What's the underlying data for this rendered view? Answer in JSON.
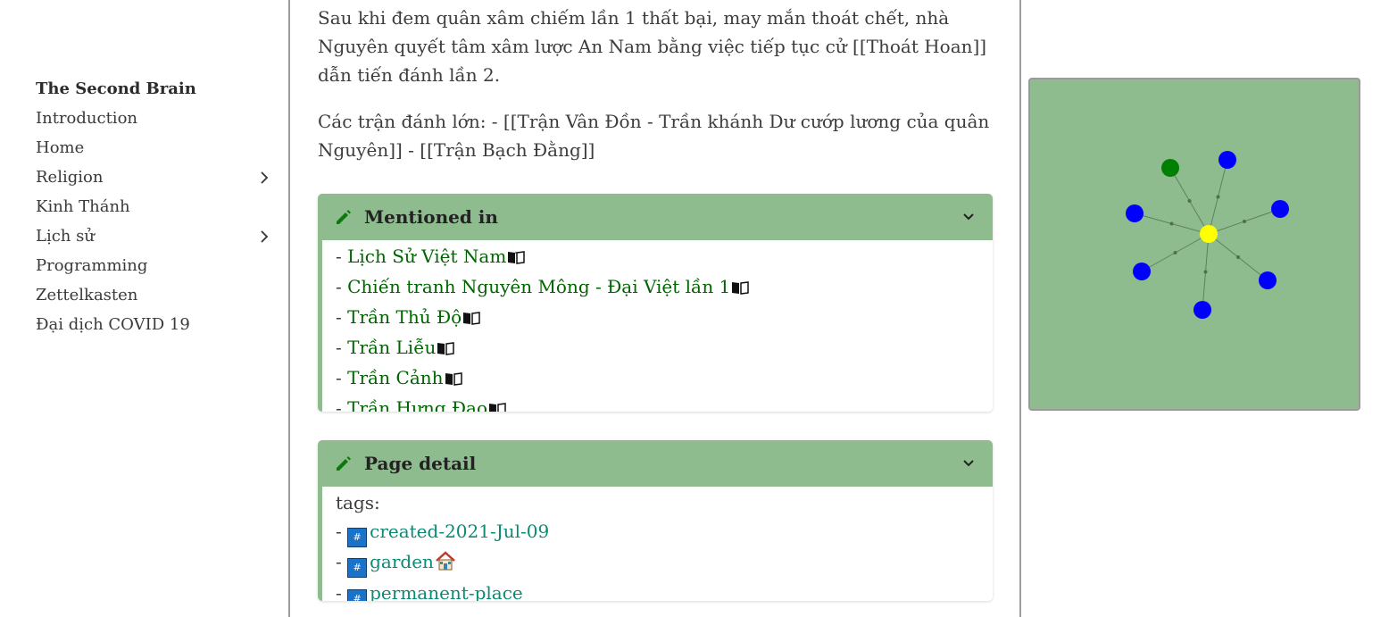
{
  "sidebar": {
    "items": [
      {
        "label": "The Second Brain",
        "brand": true,
        "expandable": false
      },
      {
        "label": "Introduction",
        "expandable": false
      },
      {
        "label": "Home",
        "expandable": false
      },
      {
        "label": "Religion",
        "expandable": true
      },
      {
        "label": "Kinh Thánh",
        "expandable": false
      },
      {
        "label": "Lịch sử",
        "expandable": true
      },
      {
        "label": "Programming",
        "expandable": false
      },
      {
        "label": "Zettelkasten",
        "expandable": false
      },
      {
        "label": "Đại dịch COVID 19",
        "expandable": false
      }
    ]
  },
  "article": {
    "paragraph1": "Sau khi đem quân xâm chiếm lần 1 thất bại, may mắn thoát chết, nhà Nguyên quyết tâm xâm lược An Nam bằng việc tiếp tục cử [[Thoát Hoan]] dẫn tiến đánh lần 2.",
    "paragraph2": "Các trận đánh lớn: - [[Trận Vân Đồn - Trần khánh Dư cướp lương của quân Nguyên]] - [[Trận Bạch Đằng]]"
  },
  "mentioned": {
    "title": "Mentioned in",
    "bullet": "- ",
    "links": [
      "Lịch Sử Việt Nam",
      "Chiến tranh Nguyên Mông - Đại Việt lần 1",
      "Trần Thủ Độ",
      "Trần Liễu",
      "Trần Cảnh",
      "Trần Hưng Đạo"
    ]
  },
  "page_detail": {
    "title": "Page detail",
    "tags_label": "tags:",
    "bullet": "- ",
    "hash_symbol": "#",
    "tags": [
      "created-2021-Jul-09",
      "garden",
      "permanent-place"
    ]
  },
  "graph": {
    "background": "#8fbc8f",
    "center_color": "#ffff00",
    "nodes": [
      {
        "color": "#008000"
      },
      {
        "color": "#0000ff"
      },
      {
        "color": "#0000ff"
      },
      {
        "color": "#0000ff"
      },
      {
        "color": "#0000ff"
      },
      {
        "color": "#0000ff"
      },
      {
        "color": "#0000ff"
      }
    ]
  },
  "colors": {
    "accent": "#8fbc8f",
    "link": "#006400",
    "tag_link": "#0b8a74"
  }
}
